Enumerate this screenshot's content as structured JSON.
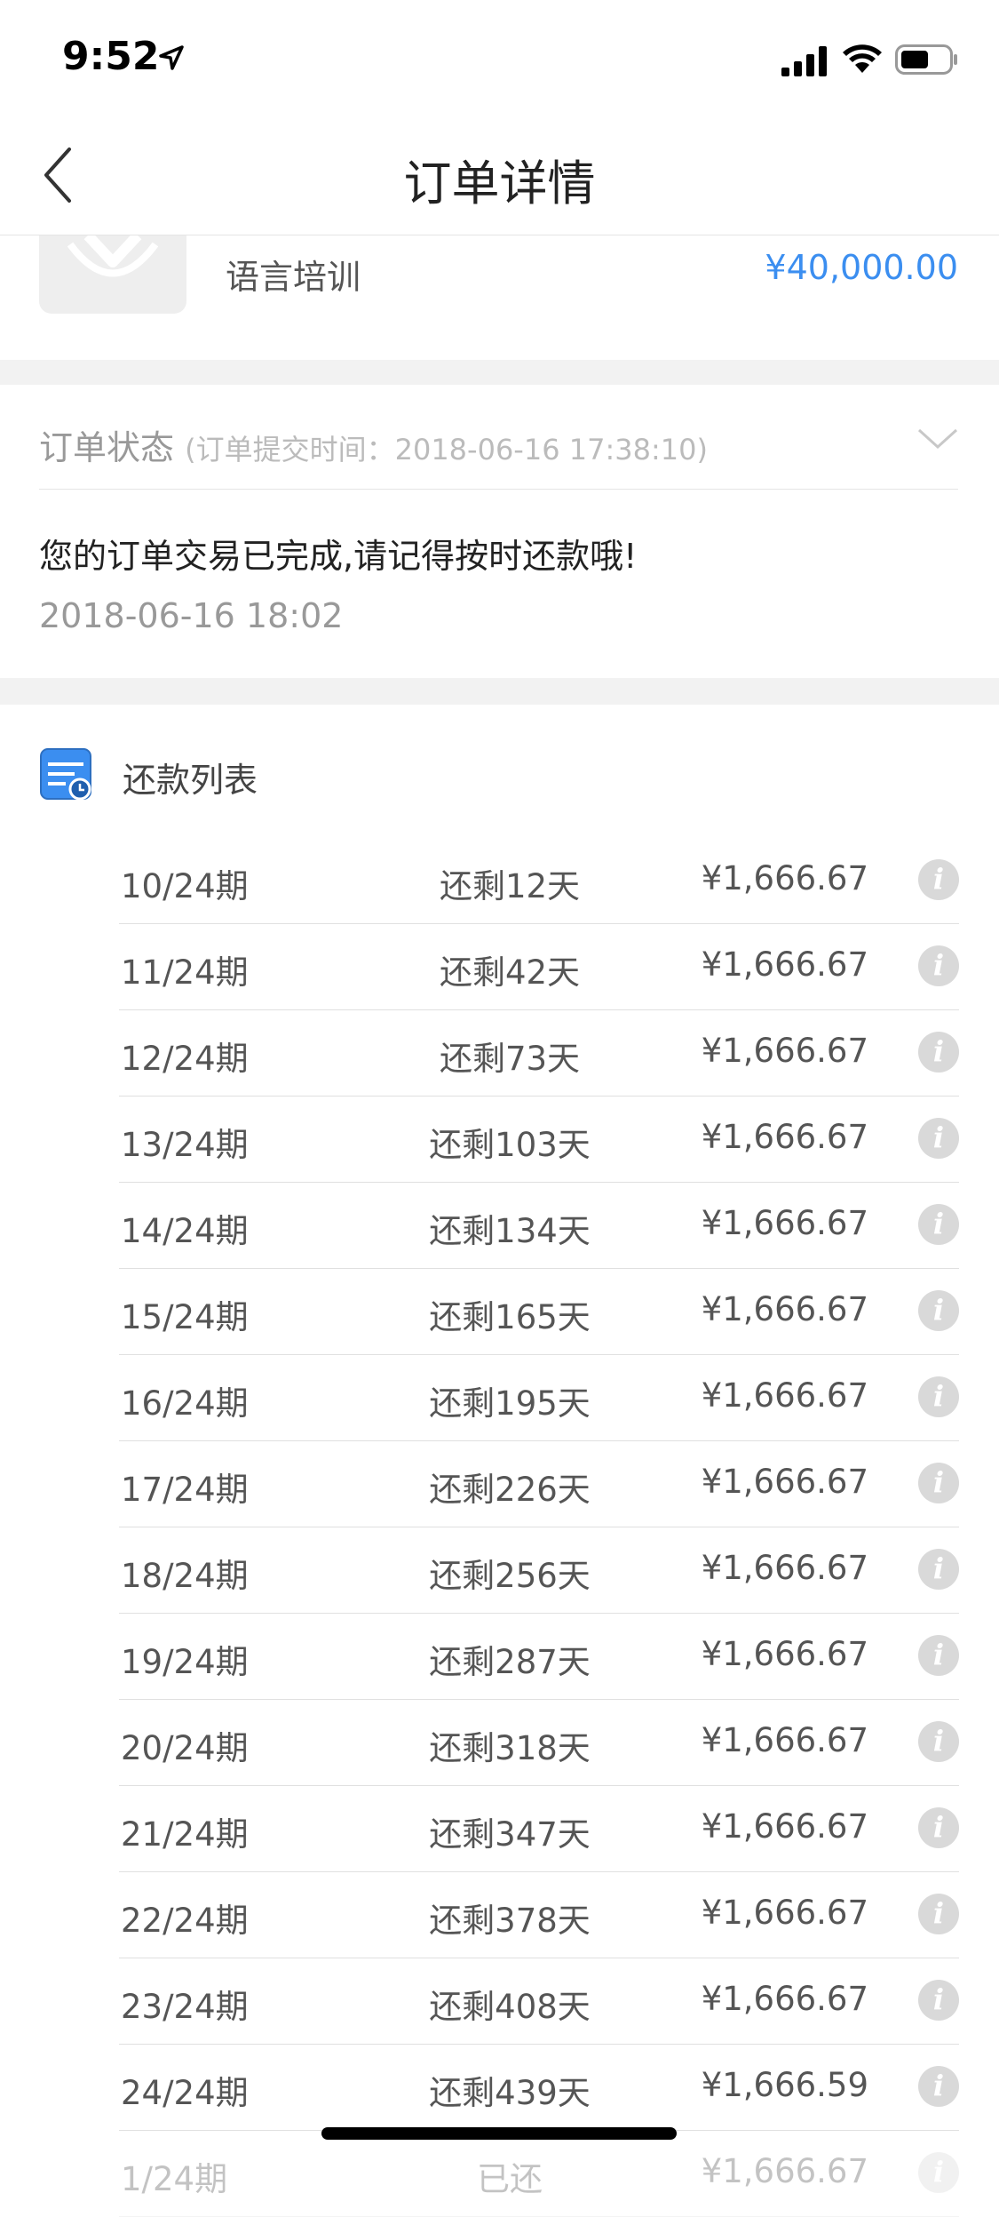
{
  "status_bar": {
    "time": "9:52"
  },
  "nav": {
    "title": "订单详情"
  },
  "product": {
    "name": "语言培训",
    "price": "¥40,000.00"
  },
  "order_status": {
    "label": "订单状态",
    "submit_time": "(订单提交时间：2018-06-16 17:38:10)",
    "message": "您的订单交易已完成,请记得按时还款哦!",
    "date": "2018-06-16 18:02"
  },
  "repayment": {
    "title": "还款列表",
    "rows": [
      {
        "period": "10/24期",
        "remaining": "还剩12天",
        "amount": "¥1,666.67"
      },
      {
        "period": "11/24期",
        "remaining": "还剩42天",
        "amount": "¥1,666.67"
      },
      {
        "period": "12/24期",
        "remaining": "还剩73天",
        "amount": "¥1,666.67"
      },
      {
        "period": "13/24期",
        "remaining": "还剩103天",
        "amount": "¥1,666.67"
      },
      {
        "period": "14/24期",
        "remaining": "还剩134天",
        "amount": "¥1,666.67"
      },
      {
        "period": "15/24期",
        "remaining": "还剩165天",
        "amount": "¥1,666.67"
      },
      {
        "period": "16/24期",
        "remaining": "还剩195天",
        "amount": "¥1,666.67"
      },
      {
        "period": "17/24期",
        "remaining": "还剩226天",
        "amount": "¥1,666.67"
      },
      {
        "period": "18/24期",
        "remaining": "还剩256天",
        "amount": "¥1,666.67"
      },
      {
        "period": "19/24期",
        "remaining": "还剩287天",
        "amount": "¥1,666.67"
      },
      {
        "period": "20/24期",
        "remaining": "还剩318天",
        "amount": "¥1,666.67"
      },
      {
        "period": "21/24期",
        "remaining": "还剩347天",
        "amount": "¥1,666.67"
      },
      {
        "period": "22/24期",
        "remaining": "还剩378天",
        "amount": "¥1,666.67"
      },
      {
        "period": "23/24期",
        "remaining": "还剩408天",
        "amount": "¥1,666.67"
      },
      {
        "period": "24/24期",
        "remaining": "还剩439天",
        "amount": "¥1,666.59"
      },
      {
        "period": "1/24期",
        "remaining": "已还",
        "amount": "¥1,666.67"
      }
    ],
    "info_glyph": "i"
  },
  "colors": {
    "accent": "#3b8ef0",
    "section_gap": "#f2f2f2"
  }
}
